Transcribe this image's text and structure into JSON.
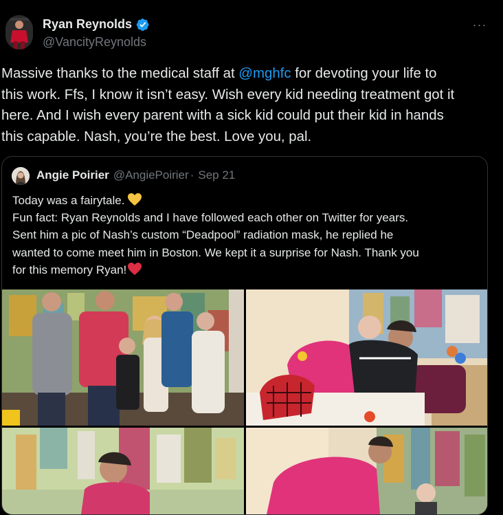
{
  "tweet": {
    "author_name": "Ryan Reynolds",
    "author_handle": "@VancityReynolds",
    "verified": true,
    "more_label": "···",
    "text_lines": [
      [
        "Massive thanks to the medical staff at ",
        "@mghfc",
        " for devoting your life to"
      ],
      "this work. Ffs, I know it isn’t easy. Wish every kid needing treatment got it",
      "here. And I wish every parent with a sick kid could put their kid in hands",
      "this capable. Nash, you’re the best. Love you, pal."
    ]
  },
  "quote": {
    "author_name": "Angie Poirier",
    "author_handle": "@AngiePoirier",
    "separator": "·",
    "date": "Sep 21",
    "line1": "Today was a fairytale.",
    "line2": "Fun fact: Ryan Reynolds and I have followed each other on Twitter for years.",
    "line3": "Sent him a pic of Nash’s custom “Deadpool” radiation mask, he replied he",
    "line4": "wanted to come meet him in Boston. We kept it a surprise for Nash. Thank you",
    "line5": "for this memory Ryan!",
    "emoji_1": "yellow-heart",
    "emoji_2": "red-heart"
  },
  "photos": [
    {
      "name": "photo-group-portrait"
    },
    {
      "name": "photo-hug"
    },
    {
      "name": "photo-mural-closeup"
    },
    {
      "name": "photo-visit"
    }
  ],
  "colors": {
    "background": "#000000",
    "text": "#e7e9ea",
    "secondary": "#71767b",
    "link": "#1d9bf0",
    "border": "#2f3336",
    "verified": "#1d9bf0"
  }
}
